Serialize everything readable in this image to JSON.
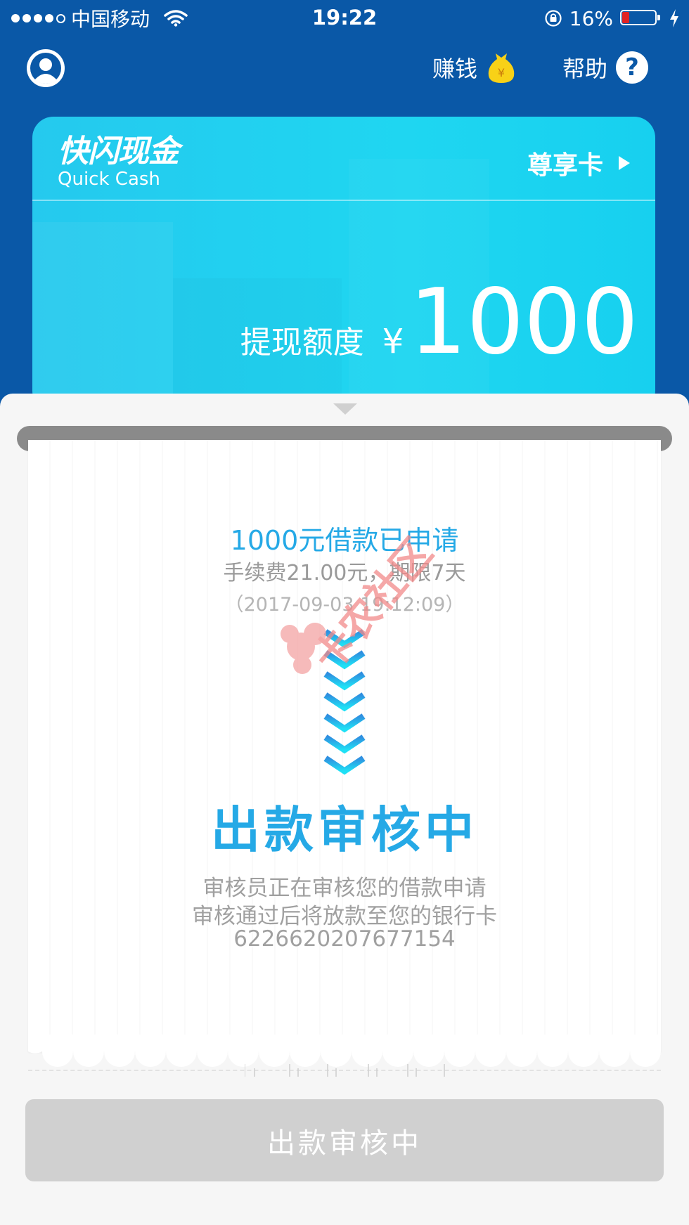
{
  "status_bar": {
    "carrier": "中国移动",
    "time": "19:22",
    "battery": "16%"
  },
  "header": {
    "earn_label": "赚钱",
    "help_label": "帮助",
    "help_symbol": "?",
    "coin_symbol": "¥"
  },
  "card": {
    "logo_cn": "快闪现金",
    "logo_en": "Quick Cash",
    "link_label": "尊享卡",
    "amount_label": "提现额度",
    "currency": "¥",
    "amount": "1000"
  },
  "receipt": {
    "apply_title": "1000元借款已申请",
    "fee_line": "手续费21.00元，期限7天",
    "time_line": "（2017-09-03 19:12:09）",
    "status_title": "出款审核中",
    "desc_line1": "审核员正在审核您的借款申请",
    "desc_line2": "审核通过后将放款至您的银行卡",
    "card_number": "6226620207677154",
    "watermark_text": "卡农社区"
  },
  "bottom_button": {
    "label": "出款审核中",
    "disabled": true
  },
  "colors": {
    "header_bg": "#0a58a7",
    "card_accent": "#1fd6f1",
    "title_blue": "#25a9e6",
    "button_disabled": "#d0d0d0"
  }
}
